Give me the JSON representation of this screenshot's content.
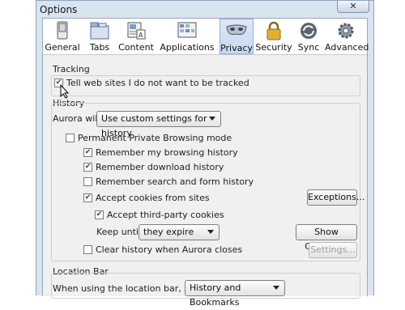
{
  "window": {
    "title": "Options",
    "close_glyph": "✕"
  },
  "toolbar": {
    "panes": [
      {
        "label": "General",
        "icon": "general-icon"
      },
      {
        "label": "Tabs",
        "icon": "tabs-icon"
      },
      {
        "label": "Content",
        "icon": "content-icon"
      },
      {
        "label": "Applications",
        "icon": "applications-icon"
      },
      {
        "label": "Privacy",
        "icon": "privacy-mask-icon",
        "selected": true
      },
      {
        "label": "Security",
        "icon": "lock-icon"
      },
      {
        "label": "Sync",
        "icon": "sync-icon"
      },
      {
        "label": "Advanced",
        "icon": "gear-icon"
      }
    ]
  },
  "tracking": {
    "title": "Tracking",
    "dnt_label": "Tell web sites I do not want to be tracked",
    "dnt_checked": true
  },
  "history": {
    "title": "History",
    "aurora_will_label": "Aurora will:",
    "aurora_will_value": "Use custom settings for history",
    "permanent_private_label": "Permanent Private Browsing mode",
    "permanent_private_checked": false,
    "remember_browsing_label": "Remember my browsing history",
    "remember_browsing_checked": true,
    "remember_download_label": "Remember download history",
    "remember_download_checked": true,
    "remember_search_label": "Remember search and form history",
    "remember_search_checked": false,
    "accept_cookies_label": "Accept cookies from sites",
    "accept_cookies_checked": true,
    "exceptions_button": "Exceptions...",
    "accept_third_party_label": "Accept third-party cookies",
    "accept_third_party_checked": true,
    "keep_until_label": "Keep until:",
    "keep_until_value": "they expire",
    "show_cookies_button": "Show Cookies...",
    "clear_history_label": "Clear history when Aurora closes",
    "clear_history_checked": false,
    "settings_button": "Settings..."
  },
  "location_bar": {
    "title": "Location Bar",
    "suggest_label": "When using the location bar, suggest:",
    "suggest_value": "History and Bookmarks"
  },
  "colors": {
    "selected_pane": "#c5d9f1",
    "window_frame": "#d9e4f1",
    "dialog_bg": "#f0f0f0"
  }
}
